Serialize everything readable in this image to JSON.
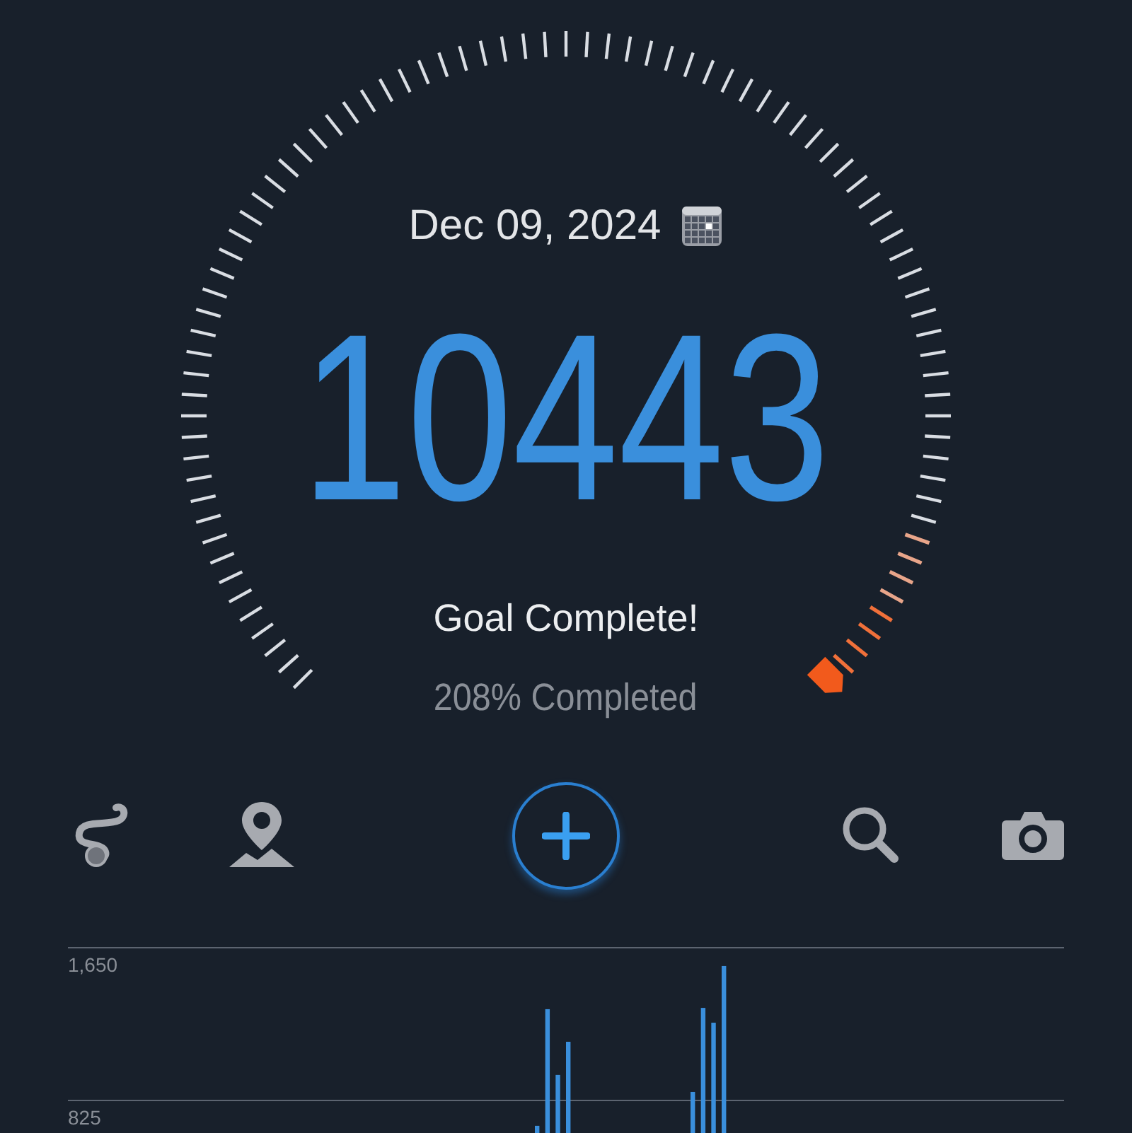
{
  "date": "Dec 09, 2024",
  "steps": "10443",
  "status": "Goal Complete!",
  "progress_text": "208% Completed",
  "chart": {
    "chart_data": {
      "type": "bar",
      "ylim": [
        650,
        1650
      ],
      "yticks": [
        {
          "value": 825,
          "label": "825"
        },
        {
          "value": 1650,
          "label": "1,650"
        }
      ],
      "values": [
        null,
        null,
        null,
        null,
        null,
        null,
        null,
        null,
        null,
        null,
        null,
        null,
        null,
        null,
        null,
        null,
        null,
        null,
        null,
        null,
        null,
        null,
        null,
        null,
        null,
        null,
        null,
        null,
        null,
        null,
        null,
        null,
        null,
        null,
        null,
        null,
        null,
        null,
        null,
        null,
        null,
        null,
        null,
        null,
        null,
        688,
        1318,
        963,
        1142,
        null,
        null,
        null,
        null,
        null,
        null,
        null,
        null,
        null,
        null,
        null,
        871,
        1325,
        1245,
        1551,
        null,
        null,
        null,
        null,
        null,
        null,
        null,
        null,
        null,
        null,
        null,
        null,
        null,
        null,
        null,
        null,
        null,
        null,
        null,
        null,
        null,
        null,
        null,
        null,
        null,
        null,
        null,
        null,
        null,
        null,
        null,
        null
      ]
    }
  }
}
